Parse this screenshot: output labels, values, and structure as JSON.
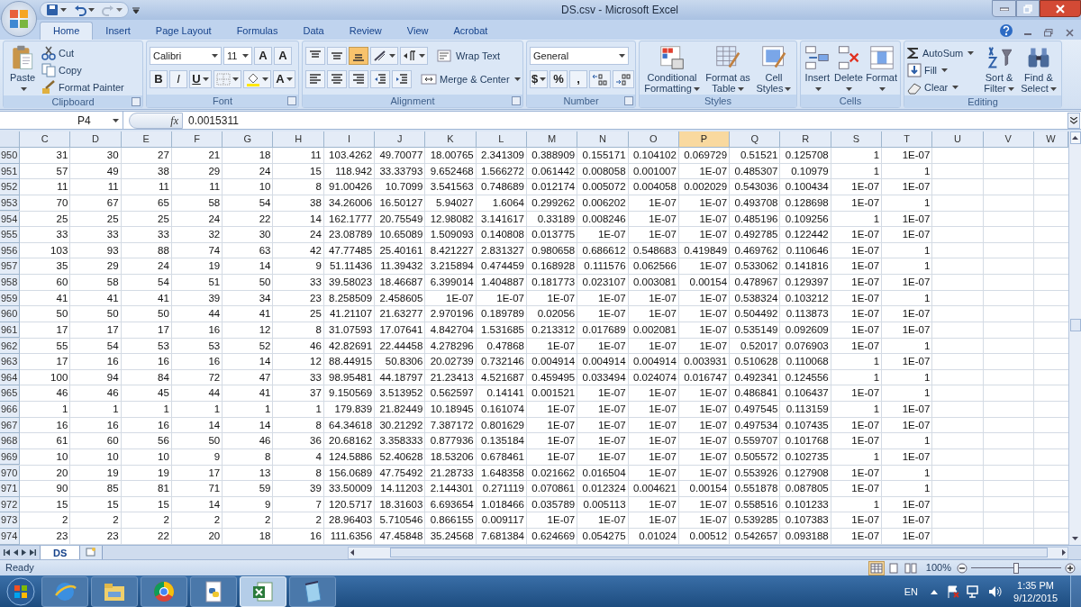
{
  "window": {
    "title": "DS.csv - Microsoft Excel"
  },
  "quick_access": [
    {
      "kind": "save",
      "disabled": false
    },
    {
      "kind": "undo",
      "disabled": false
    },
    {
      "kind": "redo",
      "disabled": true
    }
  ],
  "tabs": [
    {
      "label": "Home",
      "selected": true
    },
    {
      "label": "Insert",
      "selected": false
    },
    {
      "label": "Page Layout",
      "selected": false
    },
    {
      "label": "Formulas",
      "selected": false
    },
    {
      "label": "Data",
      "selected": false
    },
    {
      "label": "Review",
      "selected": false
    },
    {
      "label": "View",
      "selected": false
    },
    {
      "label": "Acrobat",
      "selected": false
    }
  ],
  "ribbon": {
    "groups": [
      {
        "name": "Clipboard",
        "launcher": true,
        "items": [
          {
            "kind": "large",
            "label": "Paste",
            "dropdown": true
          },
          {
            "kind": "small",
            "label": "Cut"
          },
          {
            "kind": "small",
            "label": "Copy"
          },
          {
            "kind": "small",
            "label": "Format Painter"
          }
        ]
      },
      {
        "name": "Font",
        "launcher": true,
        "lines": [
          {
            "controls": [
              {
                "kind": "field",
                "label": "Calibri",
                "dropdown": true
              },
              {
                "kind": "field",
                "label": "11",
                "dropdown": true
              },
              {
                "kind": "text",
                "label": "A"
              },
              {
                "kind": "text",
                "label": "A"
              }
            ]
          },
          {
            "controls": [
              {
                "kind": "text",
                "label": "B"
              },
              {
                "kind": "text",
                "label": "I"
              },
              {
                "kind": "text",
                "label": "U",
                "dropdown": true
              },
              {
                "kind": "icon",
                "dropdown": true
              },
              {
                "kind": "icon",
                "dropdown": true
              },
              {
                "kind": "text",
                "label": "A",
                "dropdown": true
              }
            ]
          }
        ]
      },
      {
        "name": "Alignment",
        "launcher": true,
        "lines": [
          {
            "controls": [
              {
                "kind": "icon",
                "selected": false
              },
              {
                "kind": "icon",
                "selected": false
              },
              {
                "kind": "icon",
                "selected": true
              },
              {
                "kind": "icon",
                "dropdown": true
              },
              {
                "kind": "icon",
                "dropdown": true
              },
              {
                "kind": "small",
                "label": "Wrap Text"
              }
            ]
          },
          {
            "controls": [
              {
                "kind": "icon"
              },
              {
                "kind": "icon"
              },
              {
                "kind": "icon"
              },
              {
                "kind": "icon"
              },
              {
                "kind": "icon"
              },
              {
                "kind": "small",
                "label": "Merge & Center",
                "dropdown": true
              }
            ]
          }
        ]
      },
      {
        "name": "Number",
        "launcher": true,
        "lines": [
          {
            "controls": [
              {
                "kind": "field",
                "label": "General",
                "dropdown": true
              }
            ]
          },
          {
            "controls": [
              {
                "kind": "text",
                "label": "$",
                "dropdown": true
              },
              {
                "kind": "text",
                "label": "%"
              },
              {
                "kind": "text",
                "label": ","
              },
              {
                "kind": "icon"
              },
              {
                "kind": "icon"
              }
            ]
          }
        ]
      },
      {
        "name": "Styles",
        "items": [
          {
            "kind": "large",
            "label": "Conditional Formatting",
            "dropdown": true
          },
          {
            "kind": "large",
            "label": "Format as Table",
            "dropdown": true
          },
          {
            "kind": "large",
            "label": "Cell Styles",
            "dropdown": true
          }
        ]
      },
      {
        "name": "Cells",
        "items": [
          {
            "kind": "large",
            "label": "Insert",
            "dropdown": true
          },
          {
            "kind": "large",
            "label": "Delete",
            "dropdown": true
          },
          {
            "kind": "large",
            "label": "Format",
            "dropdown": true
          }
        ]
      },
      {
        "name": "Editing",
        "items": [
          {
            "kind": "small",
            "label": "AutoSum",
            "dropdown": true
          },
          {
            "kind": "small",
            "label": "Fill",
            "dropdown": true
          },
          {
            "kind": "small",
            "label": "Clear",
            "dropdown": true
          },
          {
            "kind": "large",
            "label": "Sort & Filter",
            "dropdown": true
          },
          {
            "kind": "large",
            "label": "Find & Select",
            "dropdown": true
          }
        ]
      }
    ]
  },
  "formula_bar": {
    "name_box": "P4",
    "fx": "fx",
    "value": "0.0015311"
  },
  "columns": [
    {
      "label": "C",
      "selected": false
    },
    {
      "label": "D",
      "selected": false
    },
    {
      "label": "E",
      "selected": false
    },
    {
      "label": "F",
      "selected": false
    },
    {
      "label": "G",
      "selected": false
    },
    {
      "label": "H",
      "selected": false
    },
    {
      "label": "I",
      "selected": false
    },
    {
      "label": "J",
      "selected": false
    },
    {
      "label": "K",
      "selected": false
    },
    {
      "label": "L",
      "selected": false
    },
    {
      "label": "M",
      "selected": false
    },
    {
      "label": "N",
      "selected": false
    },
    {
      "label": "O",
      "selected": false
    },
    {
      "label": "P",
      "selected": true
    },
    {
      "label": "Q",
      "selected": false
    },
    {
      "label": "R",
      "selected": false
    },
    {
      "label": "S",
      "selected": false
    },
    {
      "label": "T",
      "selected": false
    },
    {
      "label": "U",
      "selected": false
    },
    {
      "label": "V",
      "selected": false
    },
    {
      "label": "W",
      "selected": false
    }
  ],
  "rows": [
    {
      "number": "950",
      "cells": [
        "31",
        "30",
        "27",
        "21",
        "18",
        "11",
        "103.4262",
        "49.70077",
        "18.00765",
        "2.341309",
        "0.388909",
        "0.155171",
        "0.104102",
        "0.069729",
        "0.51521",
        "0.125708",
        "1",
        "1E-07"
      ]
    },
    {
      "number": "951",
      "cells": [
        "57",
        "49",
        "38",
        "29",
        "24",
        "15",
        "118.942",
        "33.33793",
        "9.652468",
        "1.566272",
        "0.061442",
        "0.008058",
        "0.001007",
        "1E-07",
        "0.485307",
        "0.10979",
        "1",
        "1"
      ]
    },
    {
      "number": "952",
      "cells": [
        "11",
        "11",
        "11",
        "11",
        "10",
        "8",
        "91.00426",
        "10.7099",
        "3.541563",
        "0.748689",
        "0.012174",
        "0.005072",
        "0.004058",
        "0.002029",
        "0.543036",
        "0.100434",
        "1E-07",
        "1E-07"
      ]
    },
    {
      "number": "953",
      "cells": [
        "70",
        "67",
        "65",
        "58",
        "54",
        "38",
        "34.26006",
        "16.50127",
        "5.94027",
        "1.6064",
        "0.299262",
        "0.006202",
        "1E-07",
        "1E-07",
        "0.493708",
        "0.128698",
        "1E-07",
        "1"
      ]
    },
    {
      "number": "954",
      "cells": [
        "25",
        "25",
        "25",
        "24",
        "22",
        "14",
        "162.1777",
        "20.75549",
        "12.98082",
        "3.141617",
        "0.33189",
        "0.008246",
        "1E-07",
        "1E-07",
        "0.485196",
        "0.109256",
        "1",
        "1E-07"
      ]
    },
    {
      "number": "955",
      "cells": [
        "33",
        "33",
        "33",
        "32",
        "30",
        "24",
        "23.08789",
        "10.65089",
        "1.509093",
        "0.140808",
        "0.013775",
        "1E-07",
        "1E-07",
        "1E-07",
        "0.492785",
        "0.122442",
        "1E-07",
        "1E-07"
      ]
    },
    {
      "number": "956",
      "cells": [
        "103",
        "93",
        "88",
        "74",
        "63",
        "42",
        "47.77485",
        "25.40161",
        "8.421227",
        "2.831327",
        "0.980658",
        "0.686612",
        "0.548683",
        "0.419849",
        "0.469762",
        "0.110646",
        "1E-07",
        "1"
      ]
    },
    {
      "number": "957",
      "cells": [
        "35",
        "29",
        "24",
        "19",
        "14",
        "9",
        "51.11436",
        "11.39432",
        "3.215894",
        "0.474459",
        "0.168928",
        "0.111576",
        "0.062566",
        "1E-07",
        "0.533062",
        "0.141816",
        "1E-07",
        "1"
      ]
    },
    {
      "number": "958",
      "cells": [
        "60",
        "58",
        "54",
        "51",
        "50",
        "33",
        "39.58023",
        "18.46687",
        "6.399014",
        "1.404887",
        "0.181773",
        "0.023107",
        "0.003081",
        "0.00154",
        "0.478967",
        "0.129397",
        "1E-07",
        "1E-07"
      ]
    },
    {
      "number": "959",
      "cells": [
        "41",
        "41",
        "41",
        "39",
        "34",
        "23",
        "8.258509",
        "2.458605",
        "1E-07",
        "1E-07",
        "1E-07",
        "1E-07",
        "1E-07",
        "1E-07",
        "0.538324",
        "0.103212",
        "1E-07",
        "1"
      ]
    },
    {
      "number": "960",
      "cells": [
        "50",
        "50",
        "50",
        "44",
        "41",
        "25",
        "41.21107",
        "21.63277",
        "2.970196",
        "0.189789",
        "0.02056",
        "1E-07",
        "1E-07",
        "1E-07",
        "0.504492",
        "0.113873",
        "1E-07",
        "1E-07"
      ]
    },
    {
      "number": "961",
      "cells": [
        "17",
        "17",
        "17",
        "16",
        "12",
        "8",
        "31.07593",
        "17.07641",
        "4.842704",
        "1.531685",
        "0.213312",
        "0.017689",
        "0.002081",
        "1E-07",
        "0.535149",
        "0.092609",
        "1E-07",
        "1E-07"
      ]
    },
    {
      "number": "962",
      "cells": [
        "55",
        "54",
        "53",
        "53",
        "52",
        "46",
        "42.82691",
        "22.44458",
        "4.278296",
        "0.47868",
        "1E-07",
        "1E-07",
        "1E-07",
        "1E-07",
        "0.52017",
        "0.076903",
        "1E-07",
        "1"
      ]
    },
    {
      "number": "963",
      "cells": [
        "17",
        "16",
        "16",
        "16",
        "14",
        "12",
        "88.44915",
        "50.8306",
        "20.02739",
        "0.732146",
        "0.004914",
        "0.004914",
        "0.004914",
        "0.003931",
        "0.510628",
        "0.110068",
        "1",
        "1E-07"
      ]
    },
    {
      "number": "964",
      "cells": [
        "100",
        "94",
        "84",
        "72",
        "47",
        "33",
        "98.95481",
        "44.18797",
        "21.23413",
        "4.521687",
        "0.459495",
        "0.033494",
        "0.024074",
        "0.016747",
        "0.492341",
        "0.124556",
        "1",
        "1"
      ]
    },
    {
      "number": "965",
      "cells": [
        "46",
        "46",
        "45",
        "44",
        "41",
        "37",
        "9.150569",
        "3.513952",
        "0.562597",
        "0.14141",
        "0.001521",
        "1E-07",
        "1E-07",
        "1E-07",
        "0.486841",
        "0.106437",
        "1E-07",
        "1"
      ]
    },
    {
      "number": "966",
      "cells": [
        "1",
        "1",
        "1",
        "1",
        "1",
        "1",
        "179.839",
        "21.82449",
        "10.18945",
        "0.161074",
        "1E-07",
        "1E-07",
        "1E-07",
        "1E-07",
        "0.497545",
        "0.113159",
        "1",
        "1E-07"
      ]
    },
    {
      "number": "967",
      "cells": [
        "16",
        "16",
        "16",
        "14",
        "14",
        "8",
        "64.34618",
        "30.21292",
        "7.387172",
        "0.801629",
        "1E-07",
        "1E-07",
        "1E-07",
        "1E-07",
        "0.497534",
        "0.107435",
        "1E-07",
        "1E-07"
      ]
    },
    {
      "number": "968",
      "cells": [
        "61",
        "60",
        "56",
        "50",
        "46",
        "36",
        "20.68162",
        "3.358333",
        "0.877936",
        "0.135184",
        "1E-07",
        "1E-07",
        "1E-07",
        "1E-07",
        "0.559707",
        "0.101768",
        "1E-07",
        "1"
      ]
    },
    {
      "number": "969",
      "cells": [
        "10",
        "10",
        "10",
        "9",
        "8",
        "4",
        "124.5886",
        "52.40628",
        "18.53206",
        "0.678461",
        "1E-07",
        "1E-07",
        "1E-07",
        "1E-07",
        "0.505572",
        "0.102735",
        "1",
        "1E-07"
      ]
    },
    {
      "number": "970",
      "cells": [
        "20",
        "19",
        "19",
        "17",
        "13",
        "8",
        "156.0689",
        "47.75492",
        "21.28733",
        "1.648358",
        "0.021662",
        "0.016504",
        "1E-07",
        "1E-07",
        "0.553926",
        "0.127908",
        "1E-07",
        "1"
      ]
    },
    {
      "number": "971",
      "cells": [
        "90",
        "85",
        "81",
        "71",
        "59",
        "39",
        "33.50009",
        "14.11203",
        "2.144301",
        "0.271119",
        "0.070861",
        "0.012324",
        "0.004621",
        "0.00154",
        "0.551878",
        "0.087805",
        "1E-07",
        "1"
      ]
    },
    {
      "number": "972",
      "cells": [
        "15",
        "15",
        "15",
        "14",
        "9",
        "7",
        "120.5717",
        "18.31603",
        "6.693654",
        "1.018466",
        "0.035789",
        "0.005113",
        "1E-07",
        "1E-07",
        "0.558516",
        "0.101233",
        "1",
        "1E-07"
      ]
    },
    {
      "number": "973",
      "cells": [
        "2",
        "2",
        "2",
        "2",
        "2",
        "2",
        "28.96403",
        "5.710546",
        "0.866155",
        "0.009117",
        "1E-07",
        "1E-07",
        "1E-07",
        "1E-07",
        "0.539285",
        "0.107383",
        "1E-07",
        "1E-07"
      ]
    },
    {
      "number": "974",
      "cells": [
        "23",
        "23",
        "22",
        "20",
        "18",
        "16",
        "111.6356",
        "47.45848",
        "35.24568",
        "7.681384",
        "0.624669",
        "0.054275",
        "0.01024",
        "0.00512",
        "0.542657",
        "0.093188",
        "1E-07",
        "1E-07"
      ]
    }
  ],
  "sheet_tabs": [
    {
      "label": "DS",
      "selected": true
    }
  ],
  "status_bar": {
    "text": "Ready",
    "views": [
      {
        "selected": true
      },
      {
        "selected": false
      },
      {
        "selected": false
      }
    ],
    "zoom": "100%",
    "zoom_level": {
      "level": 0.5
    }
  },
  "taskbar": {
    "apps": [
      {
        "selected": false
      },
      {
        "selected": false
      },
      {
        "selected": false
      },
      {
        "selected": false
      },
      {
        "selected": true
      },
      {
        "selected": false
      }
    ],
    "language": "EN",
    "time": "1:35 PM",
    "date": "9/12/2015"
  }
}
